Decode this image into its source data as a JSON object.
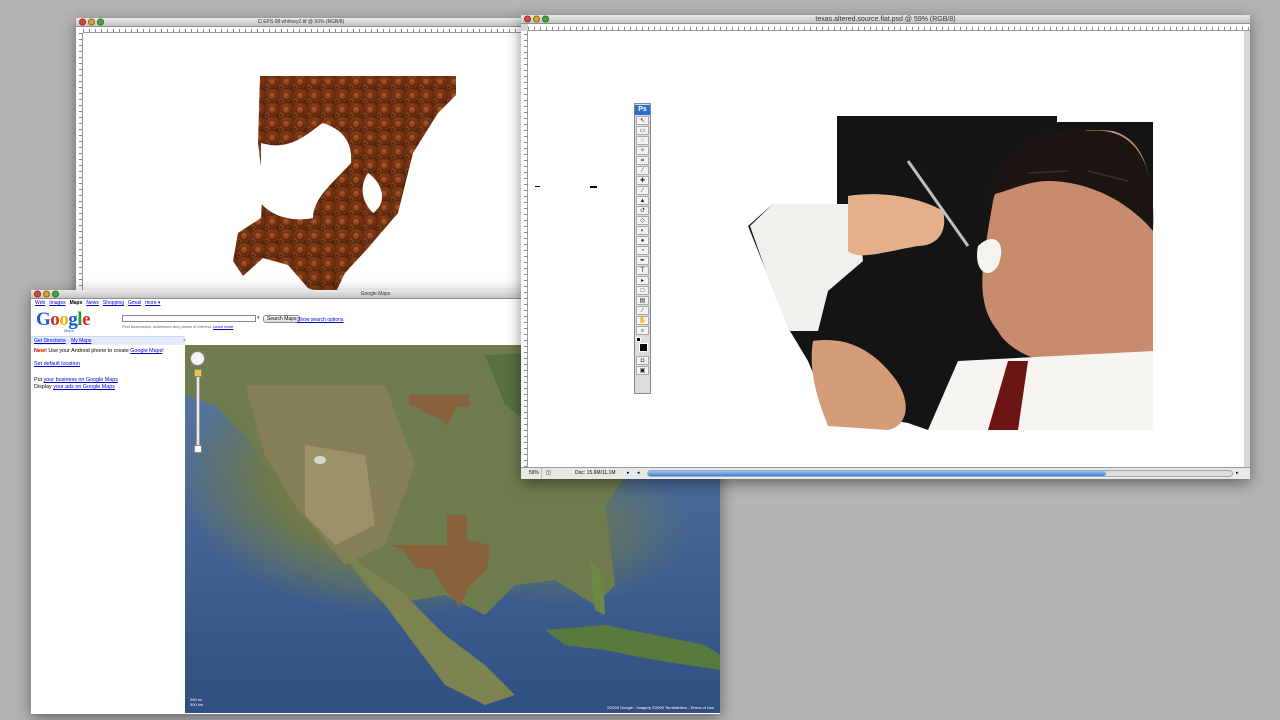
{
  "ps_small": {
    "title": "⧠ EPS 08 whitney2.tif @ 50% (RGB/8)"
  },
  "ps_main": {
    "title": "texas.altered.source.flat.psd @ 59% (RGB/8)",
    "status": {
      "zoom": "59%",
      "doc": "Doc: 15.6M/11.1M"
    },
    "toolbox_logo": "Ps"
  },
  "gmaps": {
    "title": "Google Maps",
    "nav_links": [
      "Web",
      "Images",
      "Maps",
      "News",
      "Shopping",
      "Gmail",
      "more ▾"
    ],
    "logo": "Google",
    "logo_sub": "Maps",
    "search_button": "Search Maps",
    "show_options": "Show search options",
    "find_hint": "Find businesses, addresses and places of interest.",
    "learn_more": "Learn more",
    "bar_links": [
      "Get Directions",
      "My Maps"
    ],
    "side": {
      "new_label": "New!",
      "android_text": "Use your Android phone to create",
      "android_link": "Google Maps",
      "default_location": "Set default location",
      "put_text": "Put",
      "business_link": "your business on Google Maps",
      "display_text": "Display",
      "ads_link": "your ads on Google Maps"
    },
    "scale": [
      "200 mi",
      "300 km"
    ],
    "copyright": "©2009 Google - Imagery ©2009 TerraMetrics - Terms of Use"
  }
}
